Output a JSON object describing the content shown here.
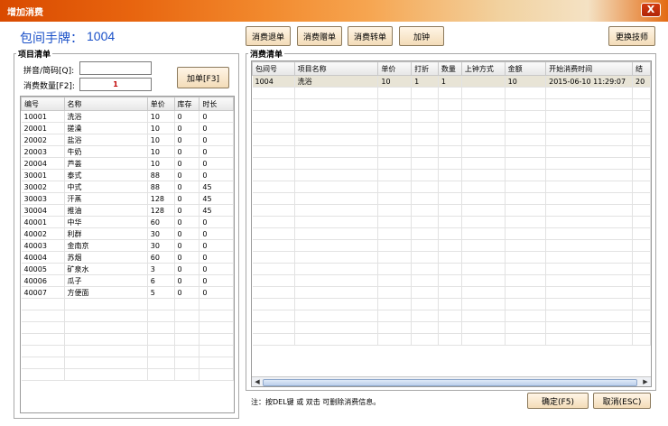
{
  "window": {
    "title": "增加消费",
    "close_symbol": "X"
  },
  "room": {
    "label": "包间手牌：",
    "value": "1004"
  },
  "left_panel": {
    "title": "项目清单",
    "pinyin_label": "拼音/简码[Q]:",
    "pinyin_value": "",
    "qty_label": "消费数量[F2]:",
    "qty_value": "1",
    "add_button": "加单[F3]",
    "columns": [
      "编号",
      "名称",
      "单价",
      "库存",
      "时长"
    ],
    "rows": [
      [
        "10001",
        "洗浴",
        "10",
        "0",
        "0"
      ],
      [
        "20001",
        "搓澡",
        "10",
        "0",
        "0"
      ],
      [
        "20002",
        "盐浴",
        "10",
        "0",
        "0"
      ],
      [
        "20003",
        "牛奶",
        "10",
        "0",
        "0"
      ],
      [
        "20004",
        "芦荟",
        "10",
        "0",
        "0"
      ],
      [
        "30001",
        "泰式",
        "88",
        "0",
        "0"
      ],
      [
        "30002",
        "中式",
        "88",
        "0",
        "45"
      ],
      [
        "30003",
        "汗蒸",
        "128",
        "0",
        "45"
      ],
      [
        "30004",
        "推油",
        "128",
        "0",
        "45"
      ],
      [
        "40001",
        "中华",
        "60",
        "0",
        "0"
      ],
      [
        "40002",
        "利群",
        "30",
        "0",
        "0"
      ],
      [
        "40003",
        "金南京",
        "30",
        "0",
        "0"
      ],
      [
        "40004",
        "苏烟",
        "60",
        "0",
        "0"
      ],
      [
        "40005",
        "矿泉水",
        "3",
        "0",
        "0"
      ],
      [
        "40006",
        "瓜子",
        "6",
        "0",
        "0"
      ],
      [
        "40007",
        "方便面",
        "5",
        "0",
        "0"
      ]
    ]
  },
  "toolbar": {
    "refund": "消费退单",
    "gift": "消费赠单",
    "transfer": "消费转单",
    "add_clock": "加钟",
    "change_tech": "更换技师"
  },
  "right_panel": {
    "title": "消费清单",
    "columns": [
      "包间号",
      "项目名称",
      "单价",
      "打折",
      "数量",
      "上钟方式",
      "金额",
      "开始消费时间",
      "结"
    ],
    "rows": [
      [
        "1004",
        "洗浴",
        "10",
        "1",
        "1",
        "",
        "10",
        "2015-06-10 11:29:07",
        "20"
      ]
    ]
  },
  "footer": {
    "note": "注：按DEL键 或 双击 可删除消费信息。",
    "ok": "确定(F5)",
    "cancel": "取消(ESC)"
  }
}
